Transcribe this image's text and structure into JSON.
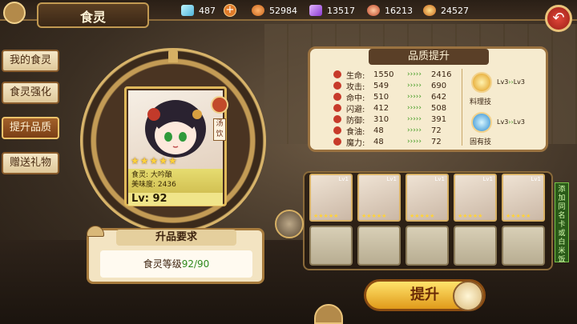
{
  "header": {
    "title": "食灵",
    "resources": [
      {
        "icon": "diamond-icon",
        "value": "487"
      },
      {
        "icon": "potion-icon",
        "value": "52984"
      },
      {
        "icon": "crystal-icon",
        "value": "13517"
      },
      {
        "icon": "meat-icon",
        "value": "16213"
      },
      {
        "icon": "coin-pot-icon",
        "value": "24527"
      }
    ]
  },
  "tabs": [
    {
      "label": "我的食灵",
      "active": false
    },
    {
      "label": "食灵强化",
      "active": false
    },
    {
      "label": "提升品质",
      "active": true
    },
    {
      "label": "赠送礼物",
      "active": false
    }
  ],
  "card": {
    "stars": "★★★★★",
    "name_line": "食灵: 大吟酿",
    "taste_line": "美味度: 2436",
    "level": "Lv: 92",
    "type_tag": "汤饮"
  },
  "requirement": {
    "title": "升品要求",
    "label": "食灵等级",
    "value": "92/90"
  },
  "stats_panel": {
    "title": "品质提升",
    "rows": [
      {
        "label": "生命:",
        "from": "1550",
        "to": "2416"
      },
      {
        "label": "攻击:",
        "from": "549",
        "to": "690"
      },
      {
        "label": "命中:",
        "from": "510",
        "to": "642"
      },
      {
        "label": "闪避:",
        "from": "412",
        "to": "508"
      },
      {
        "label": "防御:",
        "from": "310",
        "to": "391"
      },
      {
        "label": "食油:",
        "from": "48",
        "to": "72"
      },
      {
        "label": "魔力:",
        "from": "48",
        "to": "72"
      }
    ],
    "arrow": "›››››",
    "skills": [
      {
        "name": "料理技",
        "from": "Lv3",
        "to": "Lv3"
      },
      {
        "name": "固有技",
        "from": "Lv3",
        "to": "Lv3"
      }
    ]
  },
  "material_cards": [
    {
      "level": "Lv1",
      "stars": "★★★★★"
    },
    {
      "level": "Lv1",
      "stars": "★★★★★"
    },
    {
      "level": "Lv1",
      "stars": "★★★★★"
    },
    {
      "level": "Lv1",
      "stars": "★★★★★"
    },
    {
      "level": "Lv1",
      "stars": "★★★★★"
    }
  ],
  "side_note": "添加同名卡或白米饭",
  "upgrade_button": "提升",
  "colors": {
    "accent_gold": "#d7b064",
    "green": "#3d9a1e",
    "back_red": "#e2483a"
  }
}
